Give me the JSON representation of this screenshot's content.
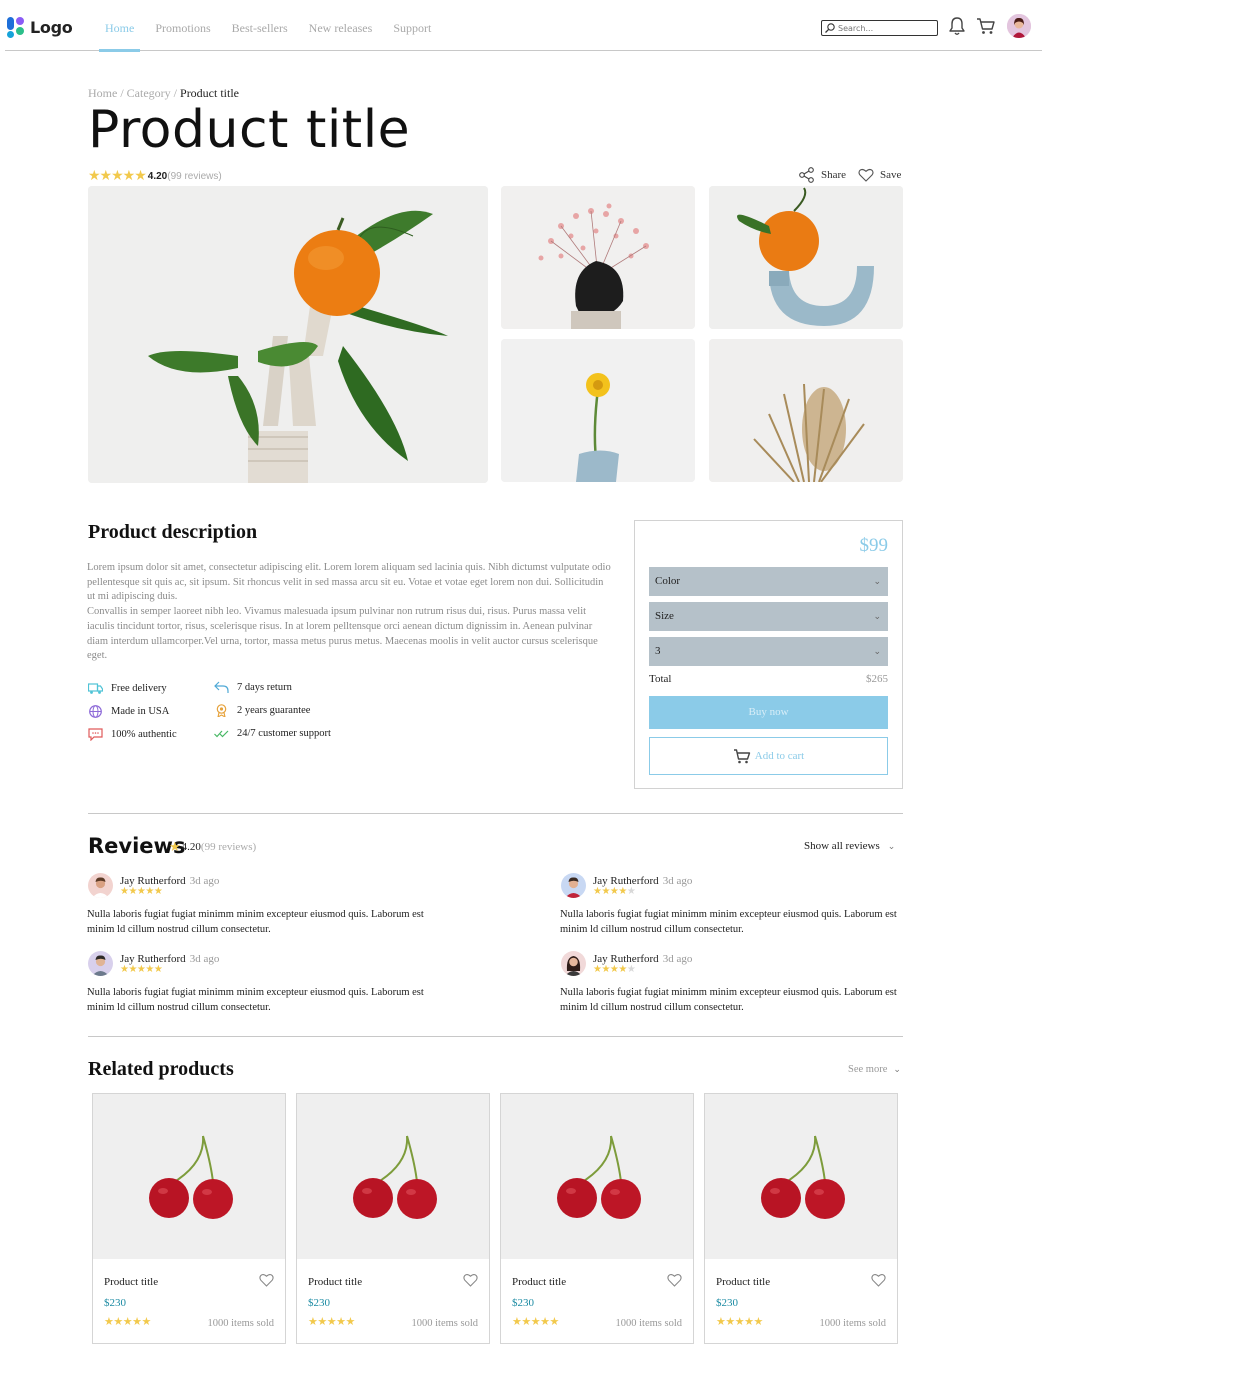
{
  "header": {
    "logo_text": "Logo",
    "nav": [
      "Home",
      "Promotions",
      "Best-sellers",
      "New releases",
      "Support"
    ],
    "active_nav": "Home",
    "search_placeholder": "Search...",
    "icons": [
      "search-icon",
      "bell-icon",
      "cart-icon",
      "avatar"
    ]
  },
  "breadcrumb": {
    "home": "Home",
    "sep": "/",
    "category": "Category",
    "current": "Product title"
  },
  "product": {
    "title": "Product title",
    "stars": "★★★★★",
    "rating": "4.20",
    "reviews": "(99 reviews)",
    "share_label": "Share",
    "save_label": "Save"
  },
  "description": {
    "title": "Product description",
    "paragraph1": "Lorem ipsum dolor sit amet, consectetur adipiscing elit. Lorem lorem aliquam sed lacinia quis. Nibh dictumst vulputate odio pellentesque sit quis ac, sit ipsum. Sit rhoncus velit in sed massa arcu sit eu. Votae et votae eget lorem non dui. Sollicitudin ut mi adipiscing duis.",
    "paragraph2": "Convallis in semper laoreet nibh leo. Vivamus malesuada ipsum pulvinar non rutrum risus dui, risus. Purus massa velit iaculis tincidunt tortor, risus, scelerisque risus. In at lorem pelltensque orci aenean dictum dignissim in. Aenean pulvinar diam interdum ullamcorper.Vel urna, tortor, massa metus purus metus. Maecenas moolis in velit auctor cursus scelerisque eget.",
    "features": [
      {
        "label": "Free delivery",
        "icon": "truck-icon",
        "color": "#4fc3d6"
      },
      {
        "label": "7 days return",
        "icon": "return-icon",
        "color": "#4fa9d6"
      },
      {
        "label": "Made in USA",
        "icon": "globe-icon",
        "color": "#8e6bd8"
      },
      {
        "label": "2 years guarantee",
        "icon": "award-icon",
        "color": "#e6a23c"
      },
      {
        "label": "100% authentic",
        "icon": "chat-icon",
        "color": "#e05a5a"
      },
      {
        "label": "24/7 customer support",
        "icon": "check-icon",
        "color": "#48b865"
      }
    ]
  },
  "purchase": {
    "price": "$99",
    "color_label": "Color",
    "size_label": "Size",
    "quantity": "3",
    "total_label": "Total",
    "total_value": "$265",
    "buy_label": "Buy now",
    "cart_label": "Add to cart",
    "accent": "#8bcbe8"
  },
  "reviews": {
    "title": "Reviews",
    "star": "★",
    "rating": "4.20",
    "count": "(99 reviews)",
    "show_all": "Show all reviews",
    "items": [
      {
        "name": "Jay Rutherford",
        "time": "3d ago",
        "stars_on": "★★★★★",
        "stars_off": "",
        "text": "Nulla laboris fugiat fugiat minimm minim excepteur eiusmod quis. Laborum est minim ld cillum nostrud cillum consectetur."
      },
      {
        "name": "Jay Rutherford",
        "time": "3d ago",
        "stars_on": "★★★★",
        "stars_off": "★",
        "text": "Nulla laboris fugiat fugiat minimm minim excepteur eiusmod quis. Laborum est minim ld cillum nostrud cillum consectetur."
      },
      {
        "name": "Jay Rutherford",
        "time": "3d ago",
        "stars_on": "★★★★★",
        "stars_off": "",
        "text": "Nulla laboris fugiat fugiat minimm minim excepteur eiusmod quis. Laborum est minim ld cillum nostrud cillum consectetur."
      },
      {
        "name": "Jay Rutherford",
        "time": "3d ago",
        "stars_on": "★★★★",
        "stars_off": "★",
        "text": "Nulla laboris fugiat fugiat minimm minim excepteur eiusmod quis. Laborum est minim ld cillum nostrud cillum consectetur."
      }
    ]
  },
  "related": {
    "title": "Related products",
    "see_more": "See more",
    "items": [
      {
        "title": "Product title",
        "price": "$230",
        "stars": "★★★★★",
        "sold": "1000 items sold"
      },
      {
        "title": "Product title",
        "price": "$230",
        "stars": "★★★★★",
        "sold": "1000 items sold"
      },
      {
        "title": "Product title",
        "price": "$230",
        "stars": "★★★★★",
        "sold": "1000 items sold"
      },
      {
        "title": "Product title",
        "price": "$230",
        "stars": "★★★★★",
        "sold": "1000 items sold"
      }
    ]
  }
}
